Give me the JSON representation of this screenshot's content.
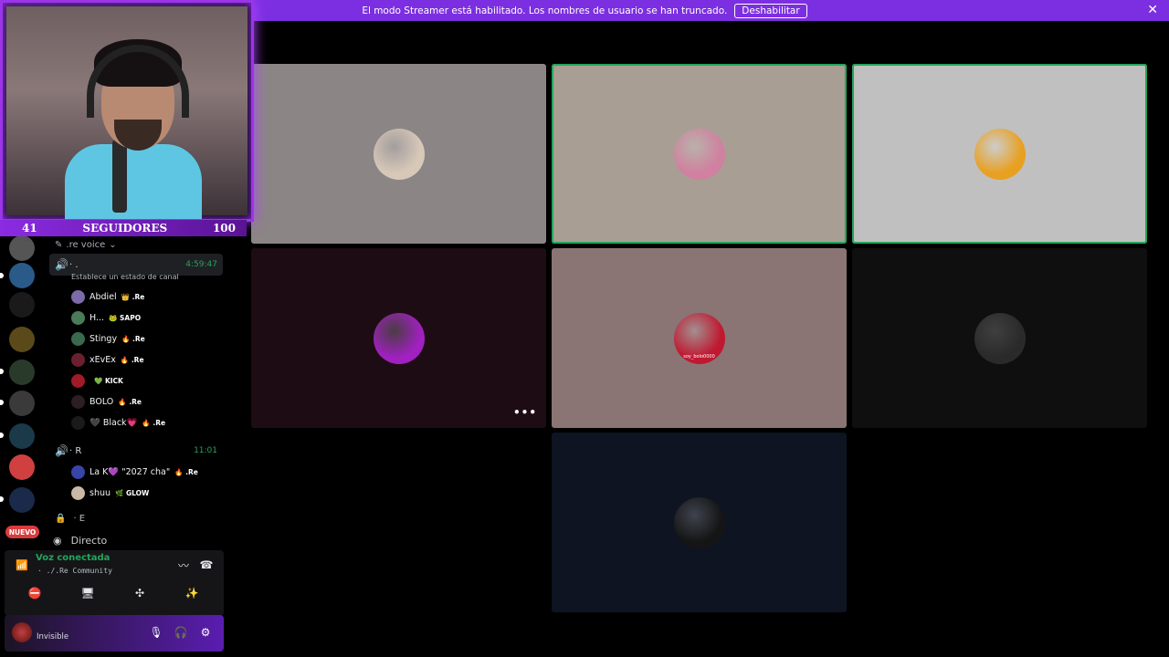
{
  "banner": {
    "message": "El modo Streamer está habilitado. Los nombres de usuario se han truncado.",
    "button": "Deshabilitar",
    "close": "✕"
  },
  "overlay": {
    "followers_current": "41",
    "followers_label": "SEGUIDORES",
    "followers_goal": "100"
  },
  "servers": {
    "new_badge": "NUEVO"
  },
  "channels": {
    "category": ".re voice",
    "voice1": {
      "name": "· .",
      "timer": "4:59:47",
      "status": "Establece un estado de canal",
      "members": [
        {
          "name": "Abdiel",
          "tag": "👑 .Re",
          "color": "#7d6aa8"
        },
        {
          "name": "H...",
          "tag": "🐸 SAPO",
          "color": "#4b7c5a"
        },
        {
          "name": "Stingy",
          "tag": "🔥 .Re",
          "color": "#3a6a4e"
        },
        {
          "name": "xEvEx",
          "tag": "🔥 .Re",
          "color": "#6b2030"
        },
        {
          "name": "",
          "tag": "💚 KICK",
          "color": "#a01a28"
        },
        {
          "name": "BOLO",
          "tag": "🔥 .Re",
          "color": "#2c1e24"
        },
        {
          "name": "🖤 Black💗",
          "tag": "🔥 .Re",
          "color": "#1a1a1a"
        }
      ]
    },
    "voice2": {
      "name": "· R",
      "timer": "11:01",
      "members": [
        {
          "name": "La K💜 \"2027 cha\"",
          "tag": "🔥 .Re",
          "color": "#3744a8"
        },
        {
          "name": "shuu",
          "tag": "🌿 GLOW",
          "color": "#c9b9a6"
        }
      ]
    },
    "locked": "· E",
    "directo": "Directo"
  },
  "voice_panel": {
    "status": "Voz conectada",
    "server": "· ./.Re Community",
    "user_status": "Invisible"
  },
  "tiles": [
    {
      "bg": "#8b8585",
      "avatar_color": "#d8c8b8",
      "speaking": false,
      "name": ""
    },
    {
      "bg": "#a89e94",
      "avatar_color": "#d080a0",
      "speaking": true,
      "name": ""
    },
    {
      "bg": "#c0c0c0",
      "avatar_color": "#e8a020",
      "speaking": true,
      "name": ""
    },
    {
      "bg": "#1e0c14",
      "avatar_color": "#a020c0",
      "speaking": false,
      "name": ""
    },
    {
      "bg": "#8a7474",
      "avatar_color": "#c01830",
      "speaking": false,
      "name": "soy_bolo0000"
    },
    {
      "bg": "#0f0f0f",
      "avatar_color": "#2a2a2a",
      "speaking": false,
      "name": ""
    },
    {
      "bg": "#0f1422",
      "avatar_color": "#151515",
      "speaking": false,
      "name": ""
    }
  ],
  "tile_more": "•••"
}
